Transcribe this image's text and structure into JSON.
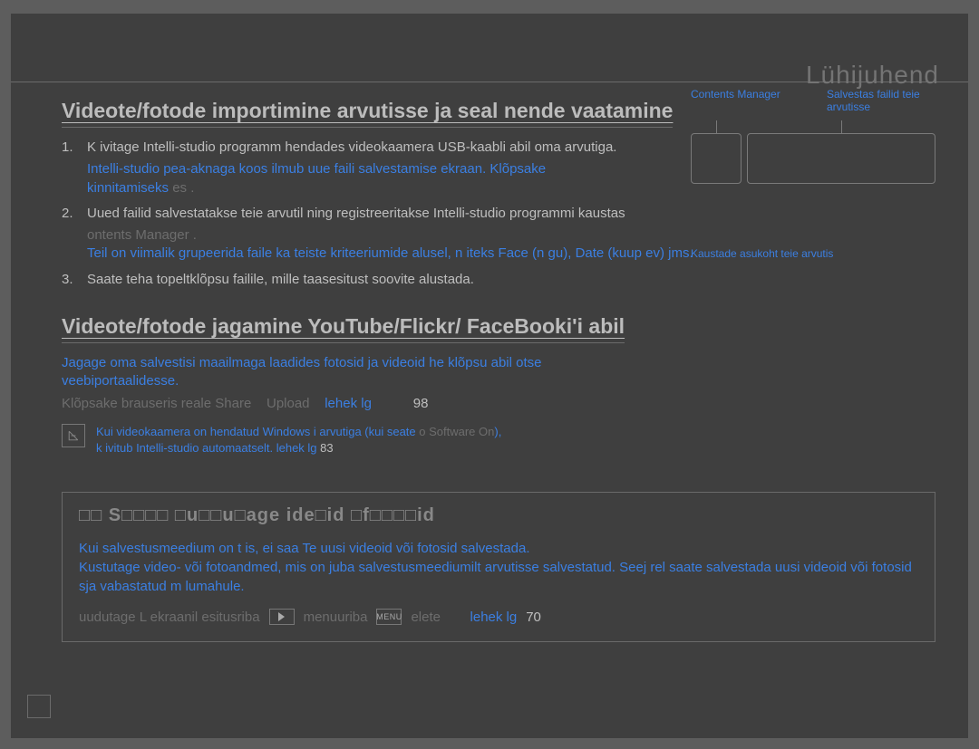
{
  "header": {
    "brand": "Lühijuhend"
  },
  "section1": {
    "heading": "Videote/fotode importimine arvutisse ja seal nende vaatamine",
    "step1_num": "1.",
    "step1_text": "K ivitage Intelli-studio programm  hendades videokaamera USB-kaabli abil oma arvutiga.",
    "step1_sub_a": "Intelli-studio pea-aknaga koos ilmub uue faili salvestamise ekraan. Klõpsake",
    "step1_sub_b": "kinnitamiseks ",
    "step1_sub_b_dim": "es .",
    "step2_num": "2.",
    "step2_text": "Uued failid salvestatakse teie arvutil ning registreeritakse Intelli-studio programmi kaustas",
    "step2_sub_a_dim": "ontents Manager .",
    "step2_sub_b": "Teil on viimalik grupeerida faile ka teiste kriteeriumide alusel, n iteks Face (n gu), Date (kuup ev) jms.",
    "step3_num": "3.",
    "step3_text": "Saate teha topeltklõpsu failile, mille taasesitust soovite alustada."
  },
  "diagram": {
    "label_cm": "Contents Manager",
    "label_save": "Salvestas failid teie arvutisse",
    "label_folder": "Kaustade asukoht teie arvutis"
  },
  "section2": {
    "heading": "Videote/fotode jagamine YouTube/Flickr/ FaceBooki'i abil",
    "p1": "Jagage oma salvestisi maailmaga laadides fotosid ja videoid  he klõpsu abil otse veebiportaalidesse.",
    "line_dim_a": "Klõpsake brauseris reale ",
    "line_dim_b": "Share",
    "line_dim_c": "Upload",
    "line_link": "lehek lg",
    "line_num": "98",
    "note_a": "Kui videokaamera on  hendatud Windows i  arvutiga (kui seate ",
    "note_a_dim": "o Software On",
    "note_a_end": "),",
    "note_b": "k ivitub  Intelli-studio  automaatselt.   ",
    "note_b_link": "lehek lg",
    "note_b_num": " 83"
  },
  "stepbox": {
    "title": "□□ S□□□□ □u□□u□age ide□id □f□□□□id",
    "p1": "Kui salvestusmeedium on t is, ei saa Te uusi videoid või fotosid salvestada.",
    "p2": "Kustutage video- või fotoandmed, mis on juba salvestusmeediumilt arvutisse salvestatud. Seej rel saate salvestada uusi videoid või fotosid  sja vabastatud m lumahule.",
    "footer_a": "uudutage L   ekraanil esitusriba ",
    "footer_b": "menuuriba ",
    "footer_c": "elete",
    "footer_link": "lehek lg",
    "footer_num": " 70",
    "icon_menu": "MENU"
  },
  "page_number": ""
}
